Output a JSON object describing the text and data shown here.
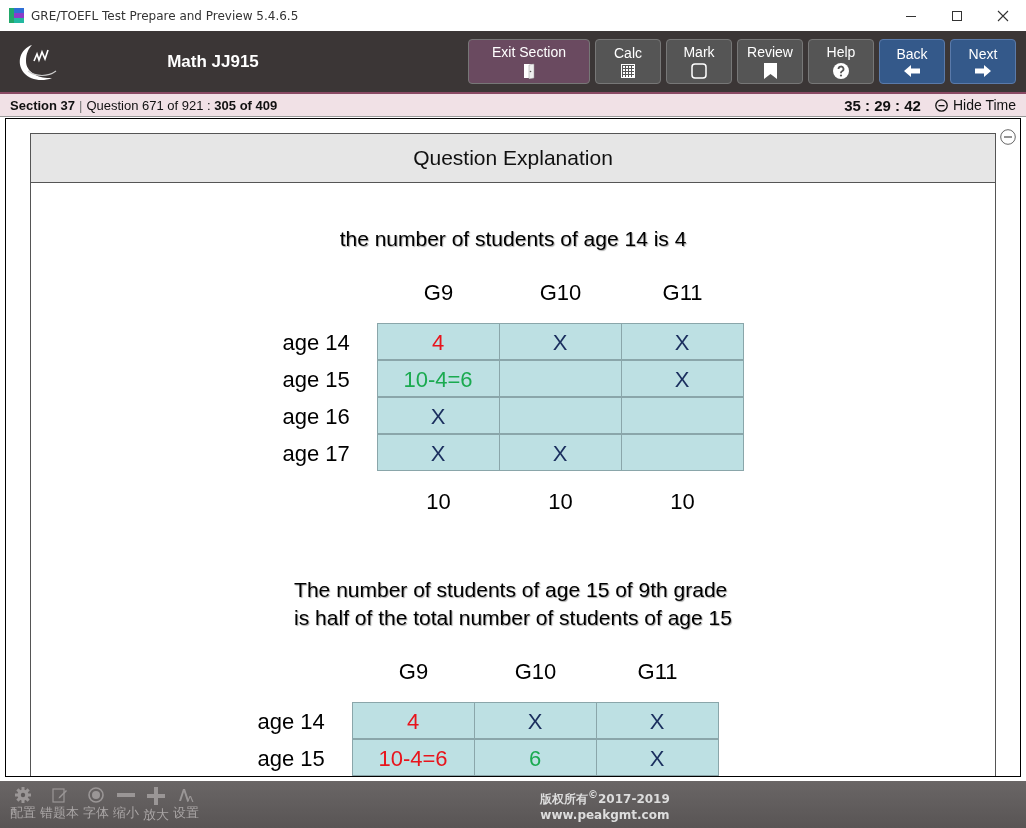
{
  "window": {
    "title": "GRE/TOEFL Test Prepare and Preview 5.4.6.5"
  },
  "header": {
    "title": "Math JJ915",
    "buttons": [
      {
        "label": "Exit Section",
        "kind": "exit"
      },
      {
        "label": "Calc",
        "kind": "calc"
      },
      {
        "label": "Mark",
        "kind": "mark"
      },
      {
        "label": "Review",
        "kind": "review"
      },
      {
        "label": "Help",
        "kind": "help"
      },
      {
        "label": "Back",
        "kind": "back"
      },
      {
        "label": "Next",
        "kind": "next"
      }
    ]
  },
  "status_bar": {
    "section": "Section 37",
    "separator": "|",
    "question": "Question 671 of 921 :",
    "progress": "305 of 409",
    "timer": "35 : 29 : 42",
    "hide_time": "Hide Time"
  },
  "panel": {
    "title": "Question Explanation",
    "blocks": [
      {
        "caption": [
          "the number of students of age 14 is 4"
        ],
        "columns": [
          "G9",
          "G10",
          "G11"
        ],
        "rows": [
          {
            "label": "age 14",
            "cells": [
              {
                "text": "4",
                "color": "#e8141c"
              },
              {
                "text": "X",
                "color": "#1a2e5e"
              },
              {
                "text": "X",
                "color": "#1a2e5e"
              }
            ]
          },
          {
            "label": "age 15",
            "cells": [
              {
                "text": "10-4=6",
                "color": "#1aaa50"
              },
              null,
              {
                "text": "X",
                "color": "#1a2e5e"
              }
            ]
          },
          {
            "label": "age 16",
            "cells": [
              {
                "text": "X",
                "color": "#1a2e5e"
              },
              null,
              null
            ]
          },
          {
            "label": "age 17",
            "cells": [
              {
                "text": "X",
                "color": "#1a2e5e"
              },
              {
                "text": "X",
                "color": "#1a2e5e"
              },
              null
            ]
          }
        ],
        "totals": [
          "10",
          "10",
          "10"
        ]
      },
      {
        "caption": [
          "The number of students of age 15 of 9th grade",
          "is half of the total number of students of age 15"
        ],
        "columns": [
          "G9",
          "G10",
          "G11"
        ],
        "rows": [
          {
            "label": "age 14",
            "cells": [
              {
                "text": "4",
                "color": "#e8141c"
              },
              {
                "text": "X",
                "color": "#1a2e5e"
              },
              {
                "text": "X",
                "color": "#1a2e5e"
              }
            ]
          },
          {
            "label": "age 15",
            "cells": [
              {
                "text": "10-4=6",
                "color": "#e8141c"
              },
              {
                "text": "6",
                "color": "#1aaa50"
              },
              {
                "text": "X",
                "color": "#1a2e5e"
              }
            ]
          }
        ]
      }
    ]
  },
  "footer": {
    "tools": [
      {
        "label": "配置",
        "kind": "gear"
      },
      {
        "label": "错题本",
        "kind": "notebook"
      },
      {
        "label": "字体",
        "kind": "font"
      },
      {
        "label": "缩小",
        "kind": "minus"
      },
      {
        "label": "放大",
        "kind": "plus"
      },
      {
        "label": "设置",
        "kind": "text"
      }
    ],
    "copyright": "版权所有$^{©}$2017-2019",
    "website": "www.peakgmt.com"
  }
}
